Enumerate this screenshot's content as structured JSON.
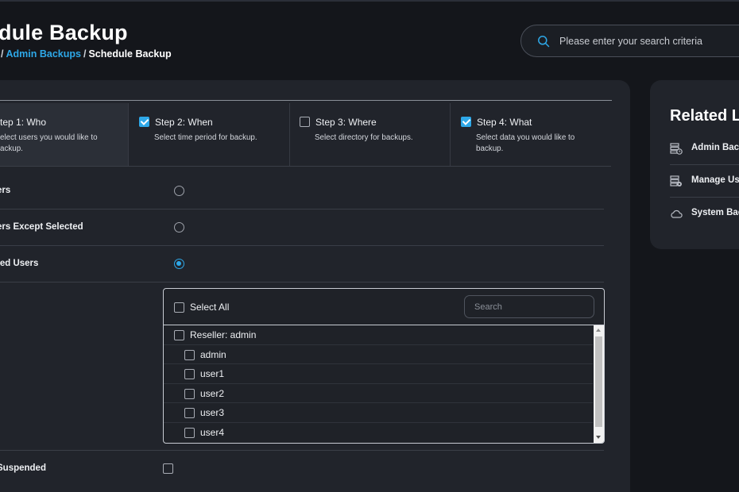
{
  "header": {
    "title": "dule Backup",
    "breadcrumb": {
      "sep1": "/",
      "admin_backups": "Admin Backups",
      "sep2": "/",
      "current": "Schedule Backup"
    }
  },
  "search": {
    "placeholder": "Please enter your search criteria",
    "value": ""
  },
  "steps": [
    {
      "title": "tep 1: Who",
      "description": "elect users you would like to ackup.",
      "checked": false,
      "active": true
    },
    {
      "title": "Step 2: When",
      "description": "Select time period for backup.",
      "checked": true,
      "active": false
    },
    {
      "title": "Step 3: Where",
      "description": "Select directory for backups.",
      "checked": false,
      "active": false
    },
    {
      "title": "Step 4: What",
      "description": "Select data you would like to backup.",
      "checked": true,
      "active": false
    }
  ],
  "who_options": [
    {
      "label": "ers",
      "selected": false
    },
    {
      "label": "ers Except Selected",
      "selected": false
    },
    {
      "label": "ted Users",
      "selected": true
    }
  ],
  "user_selector": {
    "select_all_label": "Select All",
    "search_placeholder": "Search",
    "rows": [
      {
        "label": "Reseller: admin",
        "level": 0,
        "checked": false
      },
      {
        "label": "admin",
        "level": 1,
        "checked": false
      },
      {
        "label": "user1",
        "level": 1,
        "checked": false
      },
      {
        "label": "user2",
        "level": 1,
        "checked": false
      },
      {
        "label": "user3",
        "level": 1,
        "checked": false
      },
      {
        "label": "user4",
        "level": 1,
        "checked": false
      }
    ]
  },
  "suspended": {
    "label": "Suspended",
    "checked": false
  },
  "related": {
    "title": "Related L",
    "items": [
      {
        "label": "Admin Backups",
        "icon": "server-clock-icon"
      },
      {
        "label": "Manage Users",
        "icon": "server-gear-icon"
      },
      {
        "label": "System Backup",
        "icon": "cloud-icon"
      }
    ]
  },
  "colors": {
    "accent": "#2ea8e8",
    "card": "#21242b",
    "background": "#14161b"
  }
}
